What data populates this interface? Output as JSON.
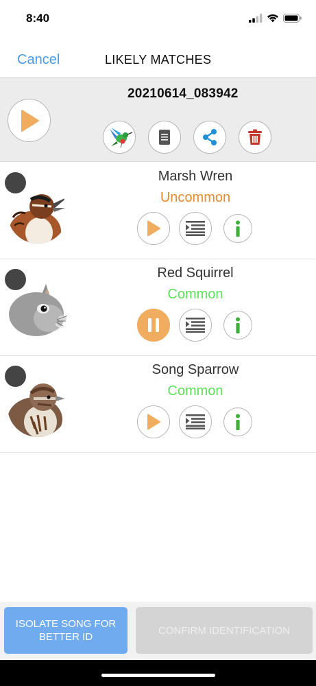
{
  "status_bar": {
    "time": "8:40",
    "icons": [
      "signal-icon",
      "wifi-icon",
      "battery-icon"
    ]
  },
  "nav": {
    "cancel_label": "Cancel",
    "title": "LIKELY MATCHES"
  },
  "recording": {
    "title": "20210614_083942",
    "actions": [
      "hummingbird-icon",
      "document-icon",
      "share-icon",
      "trash-icon"
    ]
  },
  "matches": [
    {
      "name": "Marsh Wren",
      "status": "Uncommon",
      "status_kind": "uncommon",
      "playing": false,
      "image": "marsh-wren-image"
    },
    {
      "name": "Red Squirrel",
      "status": "Common",
      "status_kind": "common",
      "playing": true,
      "image": "red-squirrel-image"
    },
    {
      "name": "Song Sparrow",
      "status": "Common",
      "status_kind": "common",
      "playing": false,
      "image": "song-sparrow-image"
    }
  ],
  "bottom": {
    "isolate_label": "ISOLATE SONG FOR BETTER ID",
    "confirm_label": "CONFIRM IDENTIFICATION"
  },
  "colors": {
    "accent_blue": "#4a9ae8",
    "play_orange": "#f0ad60",
    "uncommon": "#e88a2e",
    "common": "#5fe05b",
    "info_green": "#3fae3b",
    "trash_red": "#c0392b",
    "isolate_button": "#70abf0",
    "confirm_button_disabled": "#d4d4d4"
  }
}
